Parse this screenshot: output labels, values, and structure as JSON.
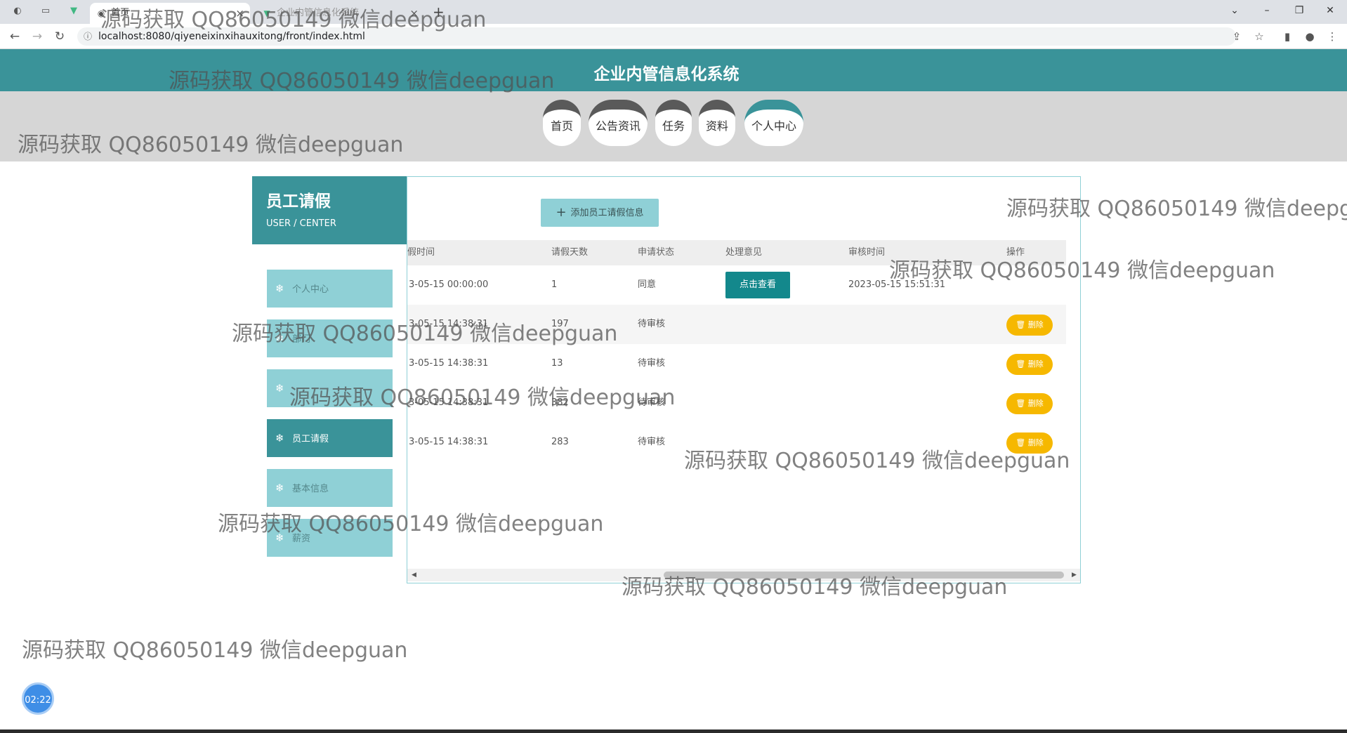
{
  "browser": {
    "tabs": [
      {
        "title": "首页",
        "active": true
      },
      {
        "title": "企业内管信息化系统",
        "active": false
      }
    ],
    "url": "localhost:8080/qiyeneixinxihauxitong/front/index.html"
  },
  "header": {
    "title": "企业内管信息化系统"
  },
  "nav": {
    "items": [
      "首页",
      "公告资讯",
      "任务",
      "资料",
      "个人中心"
    ],
    "active": "个人中心"
  },
  "sidebar": {
    "title": "员工请假",
    "subtitle": "USER / CENTER",
    "items": [
      {
        "label": "个人中心",
        "active": false
      },
      {
        "label": "部门",
        "active": false
      },
      {
        "label": "",
        "active": false
      },
      {
        "label": "员工请假",
        "active": true
      },
      {
        "label": "基本信息",
        "active": false
      },
      {
        "label": "薪资",
        "active": false
      }
    ]
  },
  "main": {
    "add_button": "添加员工请假信息",
    "columns": [
      "假时间",
      "请假天数",
      "申请状态",
      "处理意见",
      "审核时间",
      "操作"
    ],
    "rows": [
      {
        "time": "3-05-15 00:00:00",
        "days": "1",
        "status": "同意",
        "action": "点击查看",
        "review_time": "2023-05-15 15:51:31",
        "op": ""
      },
      {
        "time": "3-05-15 14:38:31",
        "days": "197",
        "status": "待审核",
        "action": "",
        "review_time": "",
        "op": "删除"
      },
      {
        "time": "3-05-15 14:38:31",
        "days": "13",
        "status": "待审核",
        "action": "",
        "review_time": "",
        "op": "删除"
      },
      {
        "time": "3-05-15 14:38:31",
        "days": "382",
        "status": "待审核",
        "action": "",
        "review_time": "",
        "op": "删除"
      },
      {
        "time": "3-05-15 14:38:31",
        "days": "283",
        "status": "待审核",
        "action": "",
        "review_time": "",
        "op": "删除"
      }
    ]
  },
  "timer": "02:22",
  "watermark": "源码获取 QQ86050149 微信deepguan",
  "colors": {
    "primary": "#3a9399",
    "light": "#8fd0d6",
    "delete": "#f6b800",
    "view": "#13888c"
  }
}
